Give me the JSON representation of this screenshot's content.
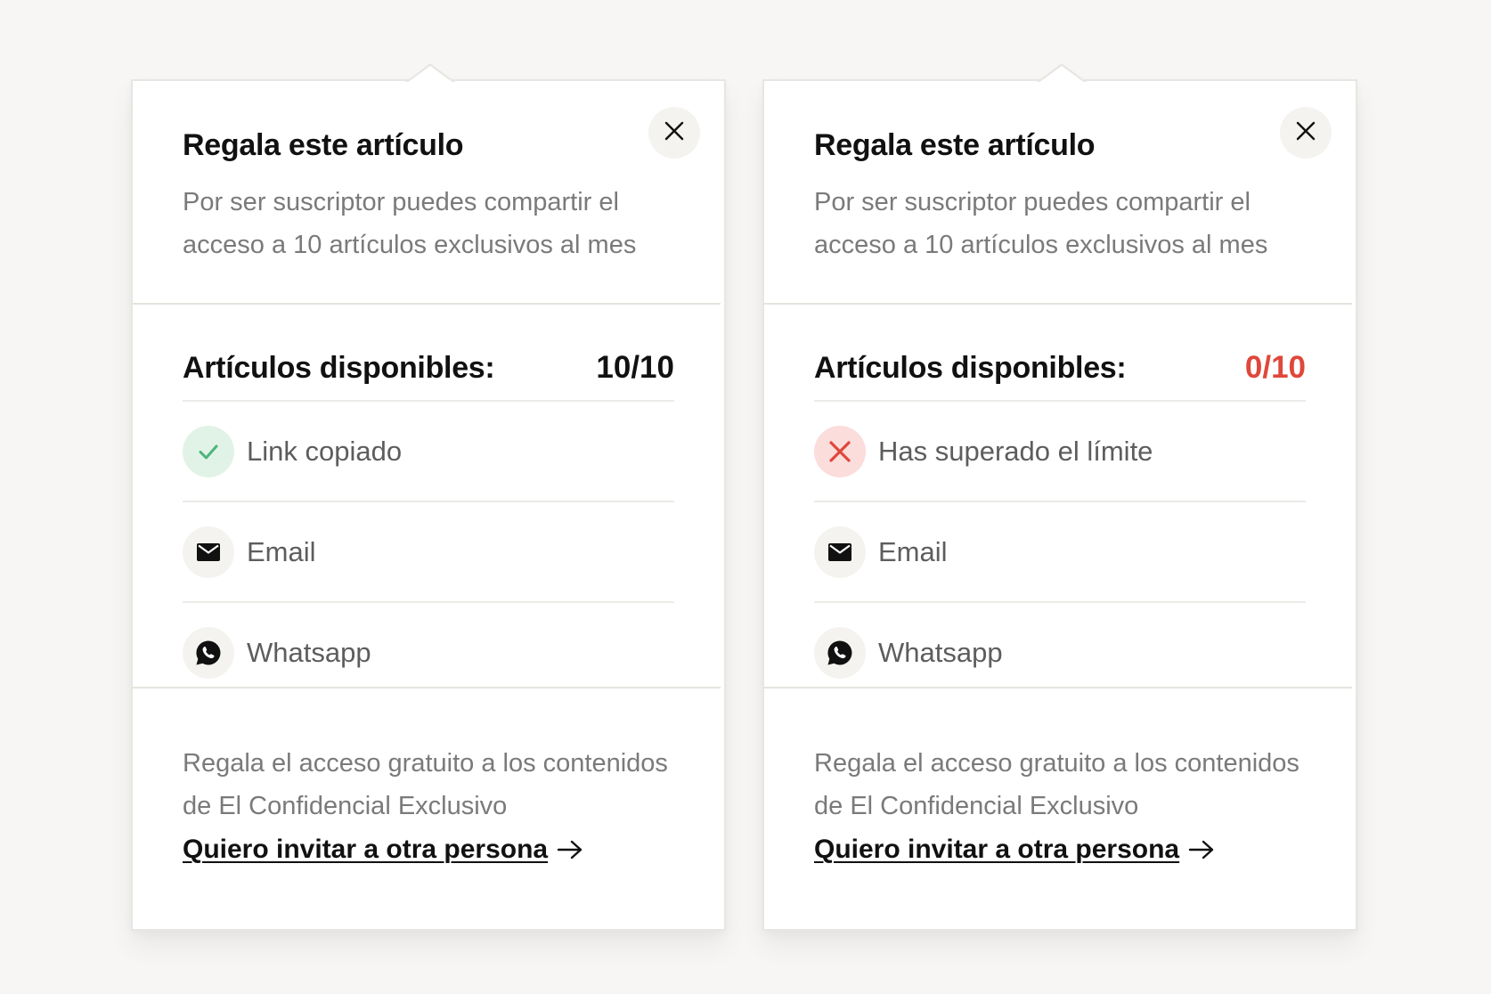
{
  "panels": [
    {
      "title": "Regala este artículo",
      "subtitle": "Por ser suscriptor puedes compartir el acceso a 10 artículos exclusivos al mes",
      "available_label": "Artículos disponibles:",
      "available_count": "10/10",
      "items": [
        {
          "label": "Link copiado",
          "icon": "check-icon",
          "state": "success"
        },
        {
          "label": "Email",
          "icon": "mail-icon"
        },
        {
          "label": "Whatsapp",
          "icon": "whatsapp-icon"
        }
      ],
      "footer_text": "Regala el acceso gratuito a los contenidos de El Confidencial Exclusivo",
      "invite_link": "Quiero invitar a otra persona"
    },
    {
      "title": "Regala este artículo",
      "subtitle": "Por ser suscriptor puedes compartir el acceso a 10 artículos exclusivos al mes",
      "available_label": "Artículos disponibles:",
      "available_count": "0/10",
      "items": [
        {
          "label": "Has superado el límite",
          "icon": "x-icon",
          "state": "error"
        },
        {
          "label": "Email",
          "icon": "mail-icon"
        },
        {
          "label": "Whatsapp",
          "icon": "whatsapp-icon"
        }
      ],
      "footer_text": "Regala el acceso gratuito a los contenidos de El Confidencial Exclusivo",
      "invite_link": "Quiero invitar a otra persona"
    }
  ],
  "colors": {
    "success": "#4cb57a",
    "error": "#e0473b",
    "text_primary": "#111111",
    "text_muted": "#7a7a7a"
  }
}
